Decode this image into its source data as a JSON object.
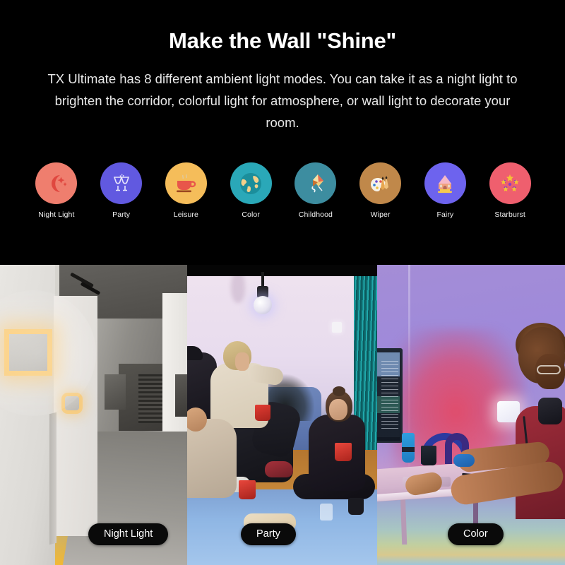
{
  "hero": {
    "title": "Make the Wall \"Shine\"",
    "subtitle": "TX Ultimate has 8 different ambient light modes. You can take it as a night light to brighten the corridor, colorful light for atmosphere, or wall light to decorate your room.",
    "background_color": "#000000",
    "title_color": "#ffffff",
    "subtitle_color": "#e9e9e9"
  },
  "modes": {
    "count": 8,
    "items": [
      {
        "label": "Night Light",
        "icon": "crescent-moon-star-icon",
        "circle_color": "#ef7e6e"
      },
      {
        "label": "Party",
        "icon": "clinking-glasses-icon",
        "circle_color": "#6159e0"
      },
      {
        "label": "Leisure",
        "icon": "coffee-cup-icon",
        "circle_color": "#f5bd5a"
      },
      {
        "label": "Color",
        "icon": "globe-icon",
        "circle_color": "#2aa8b8"
      },
      {
        "label": "Childhood",
        "icon": "kite-icon",
        "circle_color": "#3d8da0"
      },
      {
        "label": "Wiper",
        "icon": "paint-palette-icon",
        "circle_color": "#c0884a"
      },
      {
        "label": "Fairy",
        "icon": "castle-icon",
        "circle_color": "#6d63ee"
      },
      {
        "label": "Starburst",
        "icon": "firework-stars-icon",
        "circle_color": "#ef5f6e"
      }
    ]
  },
  "photos": {
    "panels": [
      {
        "pill_label": "Night Light",
        "scene": "hallway-wall-light-warm-glow"
      },
      {
        "pill_label": "Party",
        "scene": "living-room-friends-red-cups"
      },
      {
        "pill_label": "Color",
        "scene": "desk-gamer-rgb-wall-panel"
      }
    ],
    "pill_background": "#0a0a0a",
    "pill_text_color": "#ffffff"
  }
}
